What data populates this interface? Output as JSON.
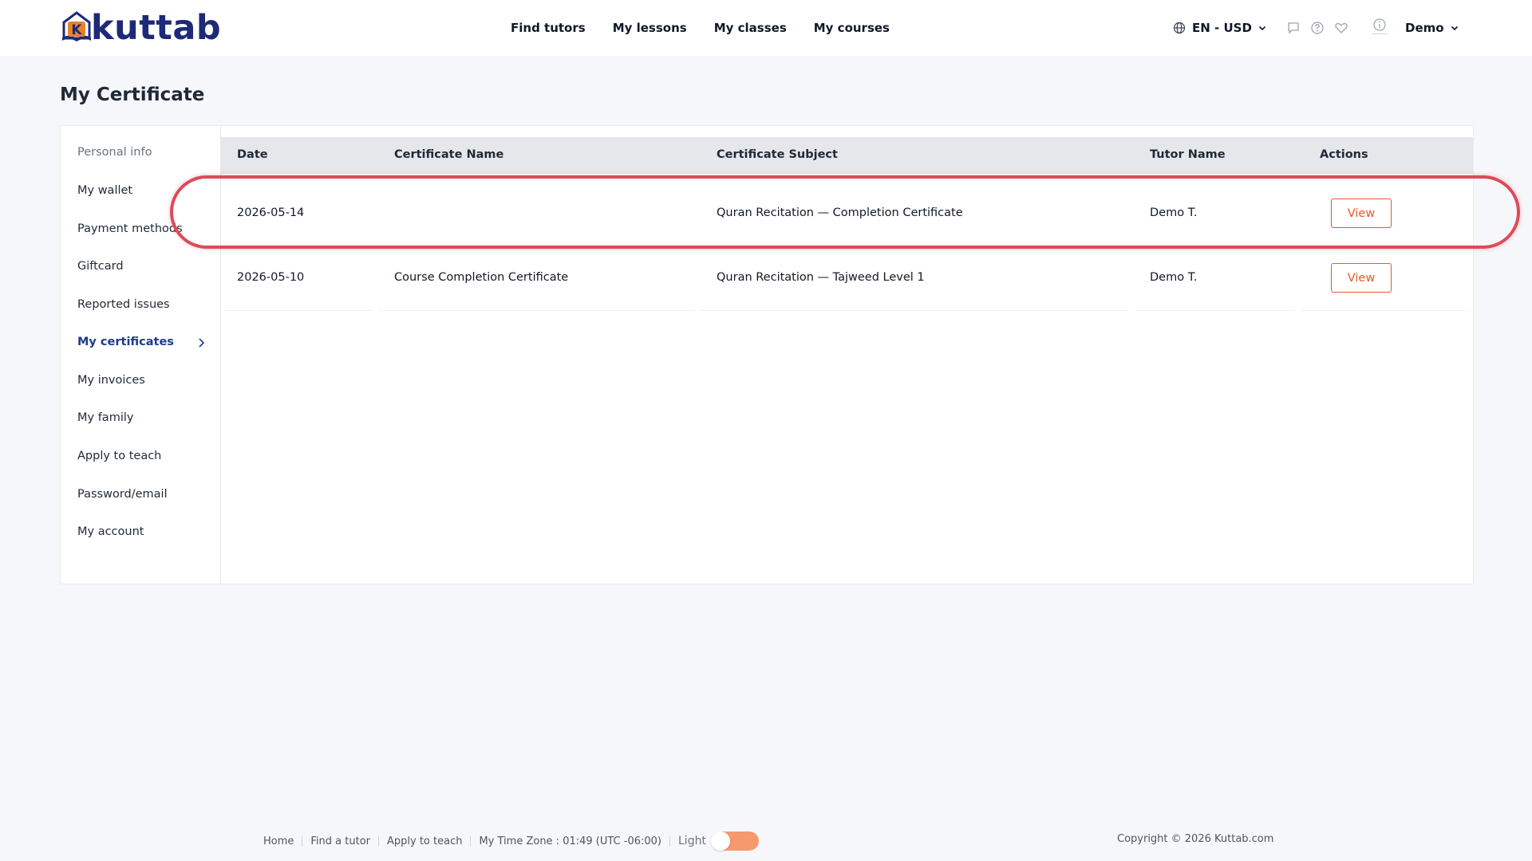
{
  "brand": {
    "name": "kuttab",
    "logo_letter": "K",
    "color": "#1e2a78",
    "accent": "#e8572a"
  },
  "nav": {
    "items": [
      "Find tutors",
      "My lessons",
      "My classes",
      "My courses"
    ]
  },
  "header": {
    "lang_currency": "EN - USD",
    "user": "Demo",
    "icons": [
      "globe-icon",
      "chat-icon",
      "help-icon",
      "heart-icon",
      "info-icon"
    ]
  },
  "page": {
    "title": "My Certificate"
  },
  "sidebar": {
    "items": [
      {
        "label": "Personal info"
      },
      {
        "label": "My wallet"
      },
      {
        "label": "Payment methods"
      },
      {
        "label": "Giftcard"
      },
      {
        "label": "Reported issues"
      },
      {
        "label": "My certificates"
      },
      {
        "label": "My invoices"
      },
      {
        "label": "My family"
      },
      {
        "label": "Apply to teach"
      },
      {
        "label": "Password/email"
      },
      {
        "label": "My account"
      }
    ],
    "active": "My certificates"
  },
  "table": {
    "columns": [
      "Date",
      "Certificate Name",
      "Certificate Subject",
      "Tutor Name",
      "Actions"
    ],
    "rows": [
      {
        "date": "2026-05-14",
        "name": "",
        "subject": "Quran Recitation — Completion Certificate",
        "tutor": "Demo T.",
        "action": "View"
      },
      {
        "date": "2026-05-10",
        "name": "Course Completion Certificate",
        "subject": "Quran Recitation — Tajweed Level 1",
        "tutor": "Demo T.",
        "action": "View"
      }
    ]
  },
  "footer": {
    "links": [
      "Home",
      "Find a tutor",
      "Apply to teach"
    ],
    "timezone": "My Time Zone : 01:49 (UTC -06:00)",
    "theme_label": "Light",
    "copyright": "Copyright © 2026 Kuttab.com"
  },
  "colors": {
    "highlight": "#de4a58",
    "toggle": "#f7996e",
    "active_nav": "#1e3a8a"
  }
}
